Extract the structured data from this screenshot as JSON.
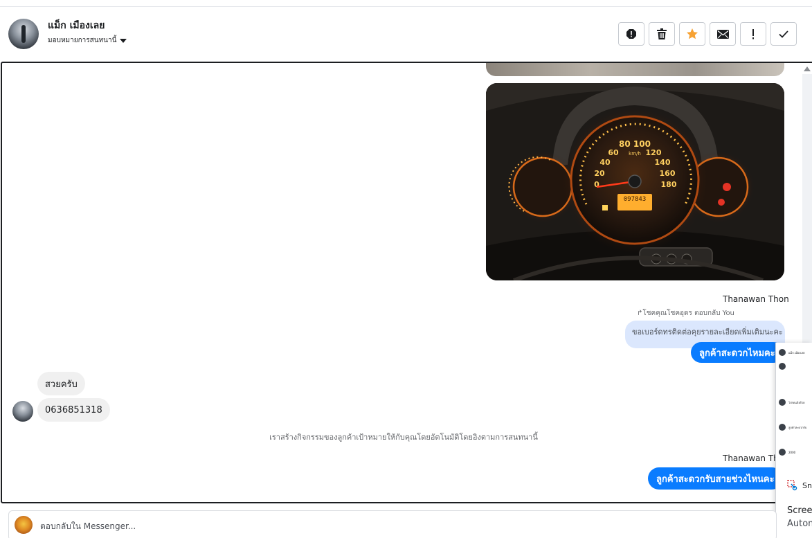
{
  "header": {
    "contact_name": "แม็ก เมืองเลย",
    "assign_label": "มอบหมายการสนทนานี้",
    "tools": [
      {
        "name": "report-icon"
      },
      {
        "name": "trash-icon"
      },
      {
        "name": "star-icon",
        "color": "#f7a233"
      },
      {
        "name": "mail-icon"
      },
      {
        "name": "exclamation-icon"
      },
      {
        "name": "check-icon"
      }
    ]
  },
  "conversation": {
    "image_main_readout": "097843",
    "dial_labels": [
      "20",
      "40",
      "60",
      "80",
      "100",
      "120",
      "140",
      "160",
      "180",
      "0",
      "km/h"
    ],
    "sender_1": "Thanawan Thon",
    "reply_hint": "โชคคุณโชคอุดร ตอบกลับ You",
    "quoted_text": "ขอเบอร์ดทรติดต่อคุยรายละเอียดเพิ่มเติมนะคะ",
    "outgoing_1": "ลูกค้าสะดวกไหมคะ",
    "incoming_1": "สวยครับ",
    "incoming_2": "0636851318",
    "system_message": "เราสร้างกิจกรรมของลูกค้าเป้าหมายให้กับคุณโดยอัตโนมัติโดยอิงตามการสนทนานี้",
    "sender_2": "Thanawan Thon",
    "outgoing_2": "ลูกค้าสะดวกรับสายช่วงไหนคะ"
  },
  "overlay": {
    "rows": [
      "แม็ก เมืองเลย",
      "",
      "โปรดแจ้งด้วย",
      "ลูกค้าสะดวกรับ",
      "2000"
    ],
    "snip_label": "Sn",
    "line1": "Screen",
    "line2": "Autom"
  },
  "composer": {
    "placeholder": "ตอบกลับใน Messenger..."
  },
  "colors": {
    "outgoing_bubble": "#0a7cff",
    "quoted_bubble": "#dbe7fd",
    "incoming_bubble": "#f0f0f0",
    "star": "#f7a233"
  }
}
